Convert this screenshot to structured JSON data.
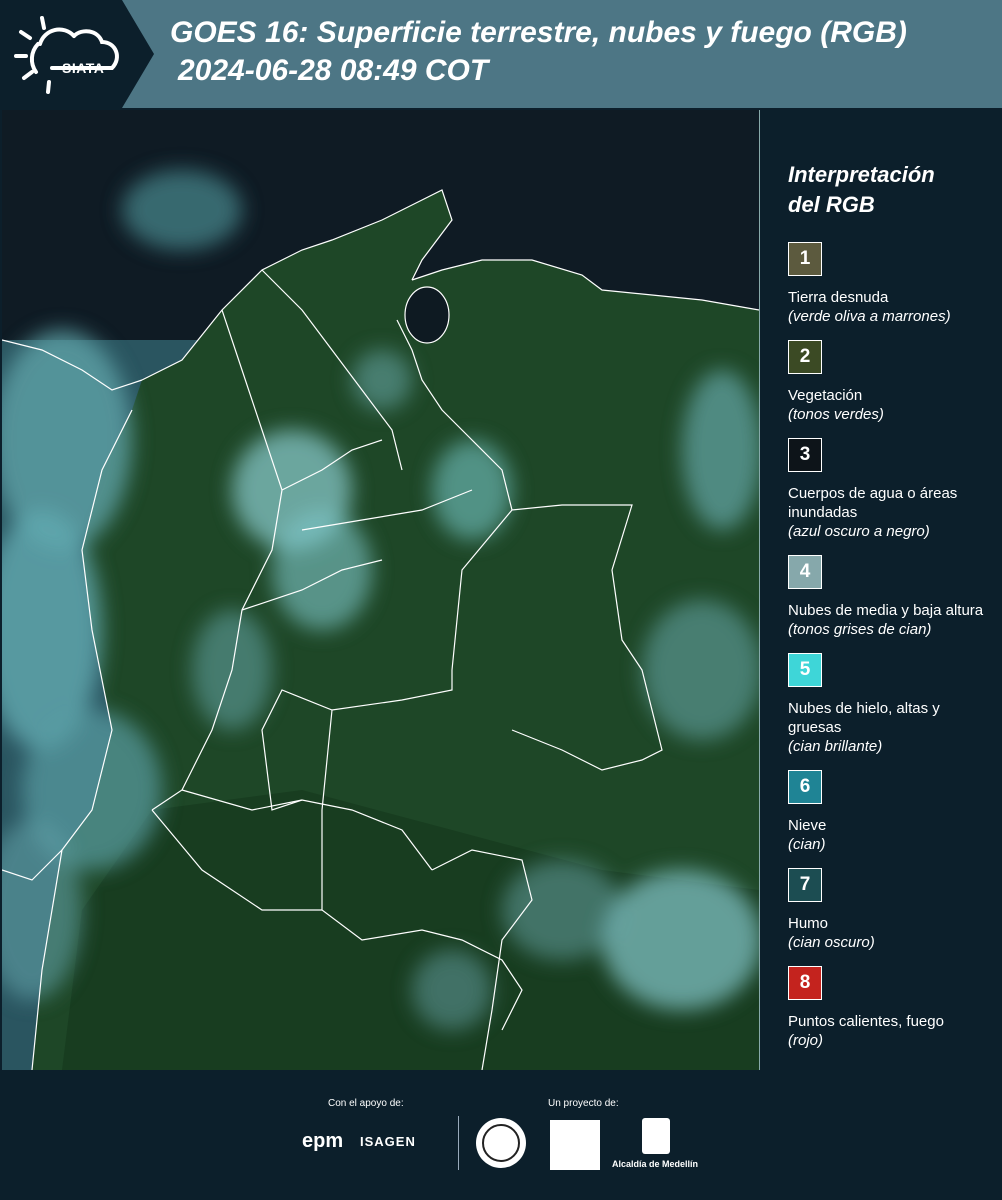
{
  "header": {
    "logo_text": "SIATA",
    "title_line1": "GOES 16: Superficie terrestre, nubes y fuego (RGB)",
    "title_line2": "2024-06-28 08:49 COT"
  },
  "legend": {
    "title_line1": "Interpretación",
    "title_line2": "del RGB",
    "items": [
      {
        "number": "1",
        "label": "Tierra desnuda",
        "desc": "(verde oliva a marrones)",
        "color": "#5c5a3e",
        "text_color": "#ffffff"
      },
      {
        "number": "2",
        "label": "Vegetación",
        "desc": "(tonos verdes)",
        "color": "#3b4a24",
        "text_color": "#ffffff"
      },
      {
        "number": "3",
        "label": "Cuerpos de agua o áreas inundadas",
        "desc": "(azul oscuro a negro)",
        "color": "#0d1419",
        "text_color": "#ffffff"
      },
      {
        "number": "4",
        "label": "Nubes de media y baja altura",
        "desc": "(tonos grises de cian)",
        "color": "#86a8ab",
        "text_color": "#ffffff"
      },
      {
        "number": "5",
        "label": "Nubes de hielo, altas y gruesas",
        "desc": "(cian brillante)",
        "color": "#3ed6d8",
        "text_color": "#ffffff"
      },
      {
        "number": "6",
        "label": "Nieve",
        "desc": "(cian)",
        "color": "#1f8495",
        "text_color": "#ffffff"
      },
      {
        "number": "7",
        "label": "Humo",
        "desc": "(cian oscuro)",
        "color": "#1c4d52",
        "text_color": "#ffffff"
      },
      {
        "number": "8",
        "label": "Puntos calientes, fuego",
        "desc": "(rojo)",
        "color": "#c4231e",
        "text_color": "#ffffff"
      }
    ]
  },
  "footer": {
    "support_label": "Con el apoyo de:",
    "project_label": "Un proyecto de:",
    "sponsor1": "epm",
    "sponsor2": "ISAGEN",
    "partner_medellin": "Alcaldía de Medellín"
  },
  "map_colors": {
    "ocean": "#101c25",
    "land": "#1f4a28",
    "land_dark": "#163a20",
    "cloud_low": "#6fa4a8",
    "cloud_ice": "#7fd8dc",
    "border": "#ffffff"
  }
}
